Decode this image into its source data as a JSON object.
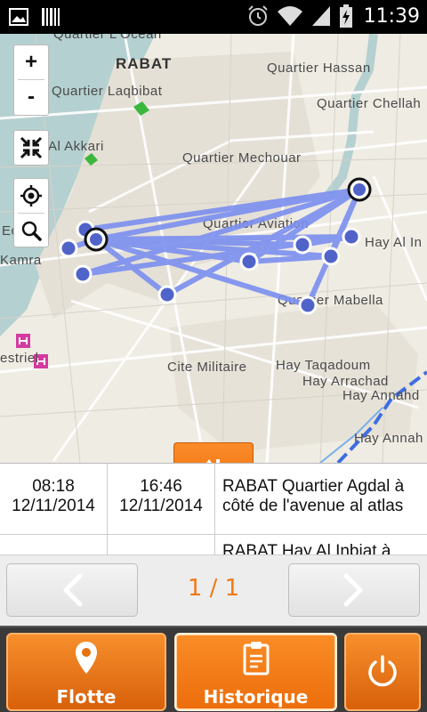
{
  "status_bar": {
    "time": "11:39",
    "icons": [
      "image-icon",
      "barcode-icon",
      "alarm-icon",
      "wifi-icon",
      "signal-icon",
      "battery-charging-icon"
    ]
  },
  "map": {
    "labels": {
      "ocean": "Quartier L'Ocean",
      "rabat": "RABAT",
      "hassan": "Quartier Hassan",
      "laqbibat": "Quartier Laqbibat",
      "chellah": "Quartier Chellah",
      "akkari": "Al Akkari",
      "mechouar": "Quartier Mechouar",
      "aviation": "Quartier Aviation",
      "ecole": "Ecole",
      "kamra": "Kamra",
      "hay_al_in": "Hay Al In",
      "mabella": "Quartier Mabella",
      "estriel": "estriel",
      "militaire": "Cite Militaire",
      "taqadoum": "Hay Taqadoum",
      "arrachad": "Hay Arrachad",
      "annahda": "Hay Annahd",
      "annah2": "Hay Annah"
    },
    "zoom_in": "+",
    "zoom_out": "-",
    "route_color": "#7b8ff0",
    "point_color": "#4f63c9"
  },
  "table": {
    "rows": [
      {
        "start_time": "08:18",
        "start_date": "12/11/2014",
        "end_time": "16:46",
        "end_date": "12/11/2014",
        "location_line1": "RABAT Quartier Agdal à",
        "location_line2": "côté de l'avenue al atlas"
      },
      {
        "start_time": "",
        "start_date": "",
        "end_time": "",
        "end_date": "",
        "location_line1": "RABAT Hay Al Inbiat à",
        "location_line2": ""
      }
    ]
  },
  "pager": {
    "indicator": "1 / 1"
  },
  "nav": {
    "flotte": "Flotte",
    "historique": "Historique"
  },
  "colors": {
    "accent": "#f07a16",
    "nav_bg": "#3a3a3a"
  }
}
